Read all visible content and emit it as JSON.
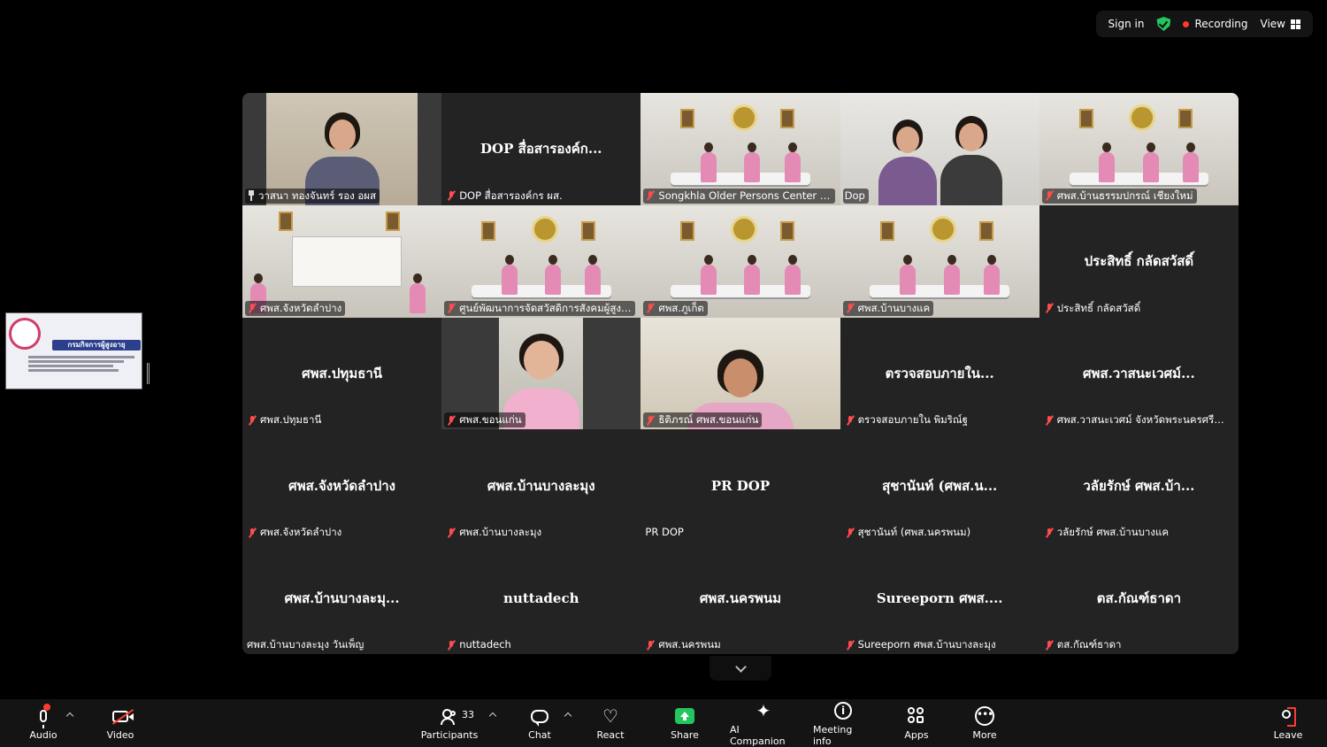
{
  "topbar": {
    "sign_in": "Sign in",
    "recording": "Recording",
    "view": "View"
  },
  "tiles": [
    {
      "label": "วาสนา ทองจันทร์ รอง อผส",
      "center": "",
      "icon": "pin-icon",
      "video": true,
      "scene": "face"
    },
    {
      "label": "DOP สื่อสารองค์กร ผส.",
      "center": "DOP สื่อสารองค์ก...",
      "icon": "mic-off-icon",
      "video": false
    },
    {
      "label": "Songkhla Older Persons Center DOP",
      "center": "",
      "icon": "mic-off-icon",
      "video": true,
      "scene": "room"
    },
    {
      "label": "Dop",
      "center": "",
      "icon": "",
      "video": true,
      "scene": "face2",
      "active": true
    },
    {
      "label": "ศพส.บ้านธรรมปกรณ์ เชียงใหม่",
      "center": "",
      "icon": "mic-off-icon",
      "video": true,
      "scene": "room"
    },
    {
      "label": "ศพส.จังหวัดลำปาง",
      "center": "",
      "icon": "mic-off-icon",
      "video": true,
      "scene": "sign"
    },
    {
      "label": "ศูนย์พัฒนาการจัดสวัสดิการสังคมผู้สูงอายุ...",
      "center": "",
      "icon": "mic-off-icon",
      "video": true,
      "scene": "room"
    },
    {
      "label": "ศพส.ภูเก็ต",
      "center": "",
      "icon": "mic-off-icon",
      "video": true,
      "scene": "room"
    },
    {
      "label": "ศพส.บ้านบางแค",
      "center": "",
      "icon": "mic-off-icon",
      "video": true,
      "scene": "room"
    },
    {
      "label": "ประสิทธิ์ กลัดสวัสดิ์",
      "center": "ประสิทธิ์ กลัดสวัสดิ์",
      "icon": "mic-off-icon",
      "video": false
    },
    {
      "label": "ศพส.ปทุมธานี",
      "center": "ศพส.ปทุมธานี",
      "icon": "mic-off-icon",
      "video": false
    },
    {
      "label": "ศพส.ขอนแก่น",
      "center": "",
      "icon": "mic-off-icon",
      "video": true,
      "scene": "face3"
    },
    {
      "label": "ธิติภรณ์ ศพส.ขอนแก่น",
      "center": "",
      "icon": "mic-off-icon",
      "video": true,
      "scene": "face4"
    },
    {
      "label": "ตรวจสอบภายใน พิมริณ์ฐ",
      "center": "ตรวจสอบภายใน...",
      "icon": "mic-off-icon",
      "video": false
    },
    {
      "label": "ศพส.วาสนะเวศม์ จังหวัดพระนครศรีอยุธยา",
      "center": "ศพส.วาสนะเวศม์...",
      "icon": "mic-off-icon",
      "video": false
    },
    {
      "label": "ศพส.จังหวัดลำปาง",
      "center": "ศพส.จังหวัดลำปาง",
      "icon": "mic-off-icon",
      "video": false
    },
    {
      "label": "ศพส.บ้านบางละมุง",
      "center": "ศพส.บ้านบางละมุง",
      "icon": "mic-off-icon",
      "video": false
    },
    {
      "label": "PR DOP",
      "center": "PR DOP",
      "icon": "",
      "video": false
    },
    {
      "label": "สุชานันท์ (ศพส.นครพนม)",
      "center": "สุชานันท์ (ศพส.น...",
      "icon": "mic-off-icon",
      "video": false
    },
    {
      "label": "วลัยรักษ์  ศพส.บ้านบางแค",
      "center": "วลัยรักษ์  ศพส.บ้า...",
      "icon": "mic-off-icon",
      "video": false
    },
    {
      "label": "ศพส.บ้านบางละมุง วันเพ็ญ",
      "center": "ศพส.บ้านบางละมุ...",
      "icon": "",
      "video": false
    },
    {
      "label": "nuttadech",
      "center": "nuttadech",
      "icon": "mic-off-icon",
      "video": false
    },
    {
      "label": "ศพส.นครพนม",
      "center": "ศพส.นครพนม",
      "icon": "mic-off-icon",
      "video": false
    },
    {
      "label": "Sureeporn ศพส.บ้านบางละมุง",
      "center": "Sureeporn ศพส....",
      "icon": "mic-off-icon",
      "video": false
    },
    {
      "label": "ตส.กัณฑ์ธาดา",
      "center": "ตส.กัณฑ์ธาดา",
      "icon": "mic-off-icon",
      "video": false
    }
  ],
  "share_thumb": {
    "banner": "กรมกิจการผู้สูงอายุ"
  },
  "toolbar": {
    "audio": "Audio",
    "video": "Video",
    "participants": "Participants",
    "participants_count": "33",
    "chat": "Chat",
    "react": "React",
    "share": "Share",
    "ai_companion": "AI Companion",
    "meeting_info": "Meeting info",
    "apps": "Apps",
    "more": "More",
    "leave": "Leave"
  },
  "colors": {
    "accent_green": "#23c55e",
    "active_speaker": "#23d160",
    "muted_red": "#ff4d4d",
    "recording_red": "#ff3b30"
  }
}
